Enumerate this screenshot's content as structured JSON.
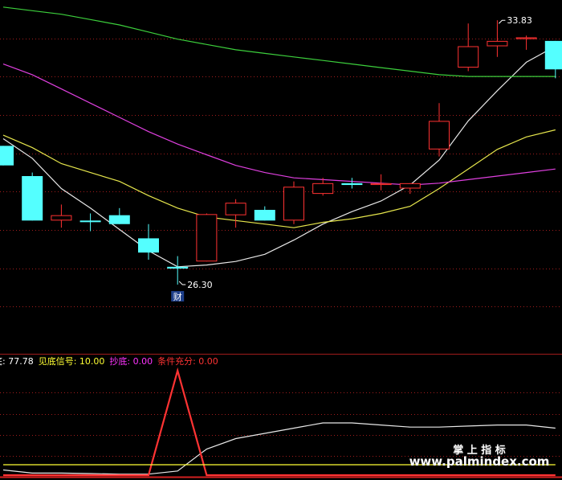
{
  "colors": {
    "background": "#000000",
    "up_candle": "#ff3232",
    "down_candle": "#54ffff",
    "ma_white": "#e8e8e8",
    "ma_yellow": "#e6e64c",
    "ma_magenta": "#e040e0",
    "ma_green": "#3ccf3c",
    "grid": "#a01c1c",
    "text_white": "#ffffff",
    "text_yellow": "#ffff33",
    "text_magenta": "#ff33ff",
    "text_red": "#ff3333"
  },
  "chart_data": [
    {
      "type": "candlestick",
      "price_scale": {
        "ylim": [
          24.5,
          34.4
        ]
      },
      "candles": [
        {
          "o": 30.3,
          "h": 30.3,
          "c": 29.75,
          "l": 29.75,
          "dir": "down"
        },
        {
          "o": 29.45,
          "h": 29.55,
          "c": 28.2,
          "l": 28.2,
          "dir": "down"
        },
        {
          "o": 28.2,
          "h": 28.65,
          "c": 28.35,
          "l": 28.0,
          "dir": "up"
        },
        {
          "o": 28.2,
          "h": 28.4,
          "c": 28.17,
          "l": 27.9,
          "dir": "down"
        },
        {
          "o": 28.35,
          "h": 28.55,
          "c": 28.1,
          "l": 28.1,
          "dir": "down"
        },
        {
          "o": 27.7,
          "h": 28.1,
          "c": 27.3,
          "l": 27.1,
          "dir": "down"
        },
        {
          "o": 26.9,
          "h": 27.2,
          "c": 26.85,
          "l": 26.4,
          "dir": "down"
        },
        {
          "o": 27.05,
          "h": 28.4,
          "c": 28.38,
          "l": 27.05,
          "dir": "up"
        },
        {
          "o": 28.35,
          "h": 28.8,
          "c": 28.7,
          "l": 28.0,
          "dir": "up"
        },
        {
          "o": 28.5,
          "h": 28.6,
          "c": 28.2,
          "l": 28.2,
          "dir": "down"
        },
        {
          "o": 28.2,
          "h": 29.3,
          "c": 29.15,
          "l": 28.1,
          "dir": "up"
        },
        {
          "o": 28.95,
          "h": 29.4,
          "c": 29.25,
          "l": 28.9,
          "dir": "up"
        },
        {
          "o": 29.25,
          "h": 29.4,
          "c": 29.2,
          "l": 29.1,
          "dir": "down"
        },
        {
          "o": 29.2,
          "h": 29.5,
          "c": 29.25,
          "l": 29.05,
          "dir": "up"
        },
        {
          "o": 29.1,
          "h": 29.25,
          "c": 29.25,
          "l": 28.95,
          "dir": "up"
        },
        {
          "o": 30.2,
          "h": 31.5,
          "c": 31.0,
          "l": 30.0,
          "dir": "up"
        },
        {
          "o": 32.5,
          "h": 33.74,
          "c": 33.1,
          "l": 32.4,
          "dir": "up"
        },
        {
          "o": 33.1,
          "h": 33.83,
          "c": 33.25,
          "l": 32.8,
          "dir": "up"
        },
        {
          "o": 33.3,
          "h": 33.4,
          "c": 33.35,
          "l": 33.0,
          "dir": "up"
        },
        {
          "o": 33.25,
          "h": 33.25,
          "c": 32.45,
          "l": 32.2,
          "dir": "down"
        }
      ],
      "moving_averages": [
        {
          "color_key": "ma_white",
          "values": [
            30.5,
            29.95,
            29.1,
            28.55,
            27.95,
            27.35,
            26.9,
            26.95,
            27.05,
            27.25,
            27.65,
            28.1,
            28.45,
            28.75,
            29.2,
            29.9,
            31.0,
            31.85,
            32.65,
            33.1
          ]
        },
        {
          "color_key": "ma_yellow",
          "values": [
            30.6,
            30.25,
            29.8,
            29.55,
            29.3,
            28.9,
            28.55,
            28.3,
            28.2,
            28.1,
            28.0,
            28.15,
            28.25,
            28.4,
            28.6,
            29.1,
            29.65,
            30.2,
            30.55,
            30.75
          ]
        },
        {
          "color_key": "ma_magenta",
          "values": [
            32.6,
            32.3,
            31.9,
            31.5,
            31.1,
            30.7,
            30.35,
            30.05,
            29.75,
            29.55,
            29.4,
            29.35,
            29.3,
            29.25,
            29.2,
            29.25,
            29.35,
            29.45,
            29.55,
            29.65
          ]
        },
        {
          "color_key": "ma_green",
          "values": [
            34.2,
            34.1,
            34.0,
            33.85,
            33.7,
            33.5,
            33.3,
            33.15,
            33.0,
            32.9,
            32.8,
            32.7,
            32.6,
            32.5,
            32.4,
            32.3,
            32.25,
            32.25,
            32.25,
            32.25
          ]
        }
      ],
      "annotations": {
        "high_label": "33.83",
        "low_label": "26.30",
        "low_marker": "财"
      }
    },
    {
      "type": "line",
      "ylim": [
        0,
        100
      ],
      "series": [
        {
          "color_key": "ma_white",
          "values": [
            5,
            2,
            2,
            1.5,
            1,
            1,
            4,
            25,
            35,
            40,
            45,
            50,
            50,
            48,
            46,
            46,
            47,
            48,
            48,
            45
          ]
        },
        {
          "color_key": "text_red",
          "values": [
            0,
            0,
            0,
            0,
            0,
            0,
            100,
            0,
            0,
            0,
            0,
            0,
            0,
            0,
            0,
            0,
            0,
            0,
            0,
            0
          ]
        },
        {
          "color_key": "text_yellow",
          "values": [
            10,
            10,
            10,
            10,
            10,
            10,
            10,
            10,
            10,
            10,
            10,
            10,
            10,
            10,
            10,
            10,
            10,
            10,
            10,
            10
          ]
        }
      ],
      "legend": [
        {
          "name": "底",
          "value": "77.78",
          "color_key": "text_white"
        },
        {
          "name": "见底信号",
          "value": "10.00",
          "color_key": "text_yellow"
        },
        {
          "name": "抄底",
          "value": "0.00",
          "color_key": "text_magenta"
        },
        {
          "name": "条件充分",
          "value": "0.00",
          "color_key": "text_red"
        }
      ]
    }
  ],
  "watermark": {
    "title": "掌 上 指 标",
    "url": "www.palmindex.com"
  }
}
